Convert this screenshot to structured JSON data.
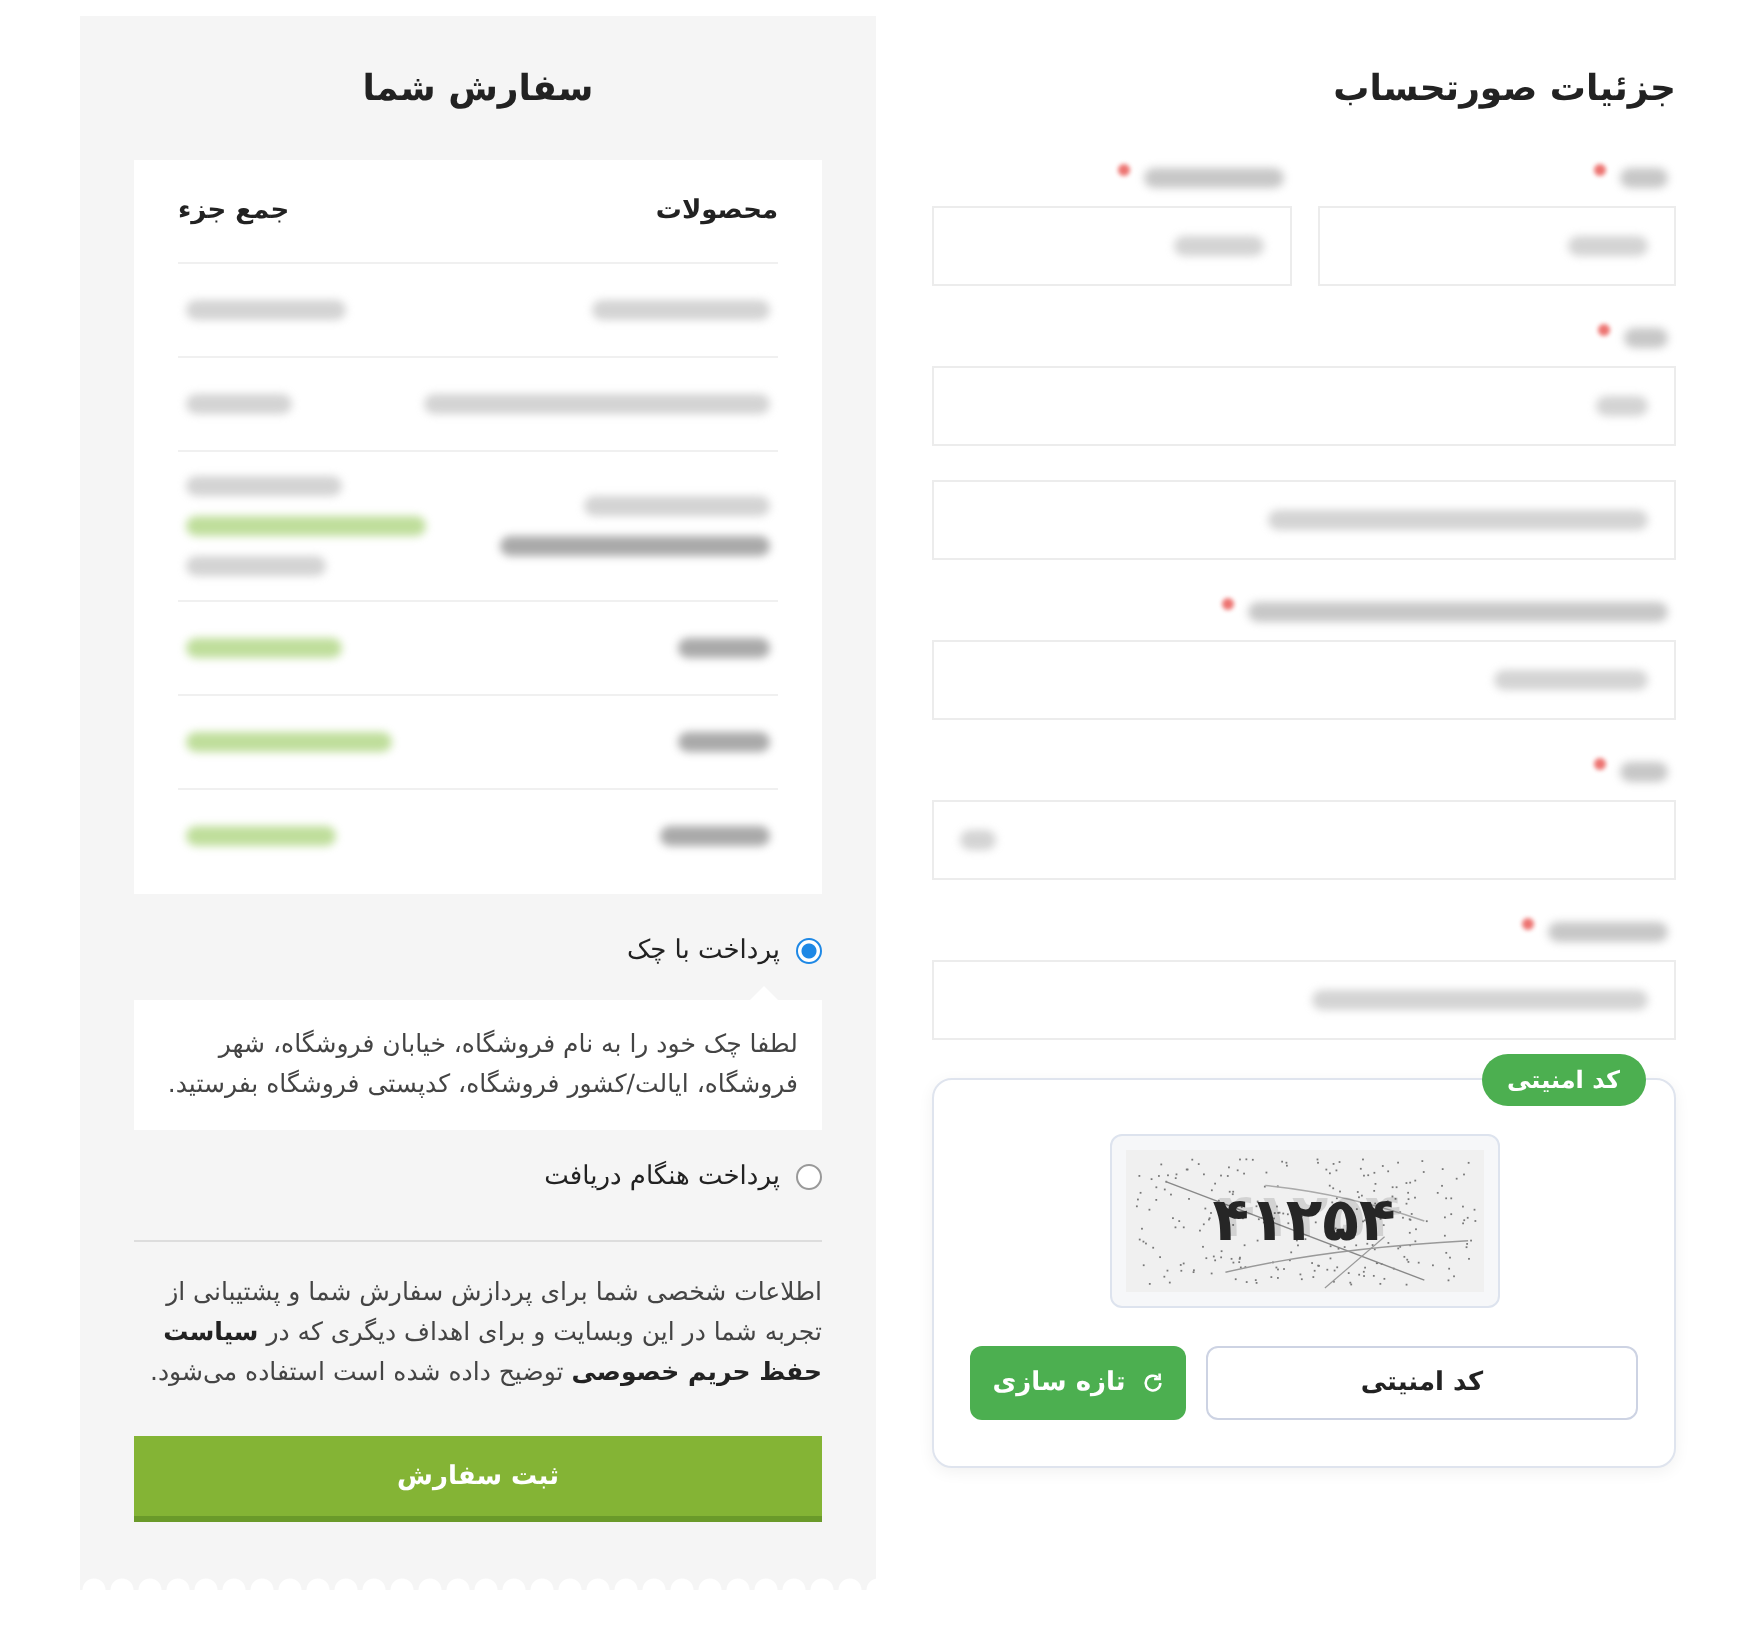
{
  "billing": {
    "title": "جزئیات صورتحساب",
    "rows": [
      {
        "fields": [
          {
            "kind": "labeled",
            "required": true,
            "ltr": false
          },
          {
            "kind": "labeled",
            "required": true,
            "ltr": false
          }
        ]
      },
      {
        "fields": [
          {
            "kind": "labeled",
            "required": true,
            "ltr": false
          }
        ]
      },
      {
        "fields": [
          {
            "kind": "plain",
            "ltr": false
          }
        ]
      },
      {
        "fields": [
          {
            "kind": "labeled",
            "required": true,
            "ltr": false
          }
        ]
      },
      {
        "fields": [
          {
            "kind": "labeled",
            "required": true,
            "ltr": true
          }
        ]
      },
      {
        "fields": [
          {
            "kind": "labeled",
            "required": true,
            "ltr": false
          }
        ]
      }
    ],
    "captcha": {
      "badge": "کد امنیتی",
      "code": "۴۱۲۵۴",
      "input": {
        "placeholder": "کد امنیتی"
      },
      "refresh_button": "تازه سازی"
    }
  },
  "order": {
    "title": "سفارش شما",
    "columns": [
      "محصولات",
      "جمع جزء"
    ],
    "rows": [
      {
        "kind": "item"
      },
      {
        "kind": "item"
      },
      {
        "kind": "detailed"
      },
      {
        "kind": "total"
      },
      {
        "kind": "total"
      },
      {
        "kind": "total"
      }
    ]
  },
  "payment": {
    "methods": [
      {
        "label": "پرداخت با چک",
        "selected": true,
        "description": "لطفا چک خود را به نام فروشگاه، خیابان فروشگاه، شهر فروشگاه، ایالت/کشور فروشگاه، کدپستی فروشگاه بفرستید."
      },
      {
        "label": "پرداخت هنگام دریافت",
        "selected": false
      }
    ]
  },
  "privacy_notice": "اطلاعات شخصی شما برای پردازش سفارش شما و پشتیبانی از تجربه شما در این وبسایت و برای اهداف دیگری که در **سیاست حفظ حریم خصوصی** توضیح داده شده است استفاده می‌شود.",
  "place_order_button": "ثبت سفارش"
}
